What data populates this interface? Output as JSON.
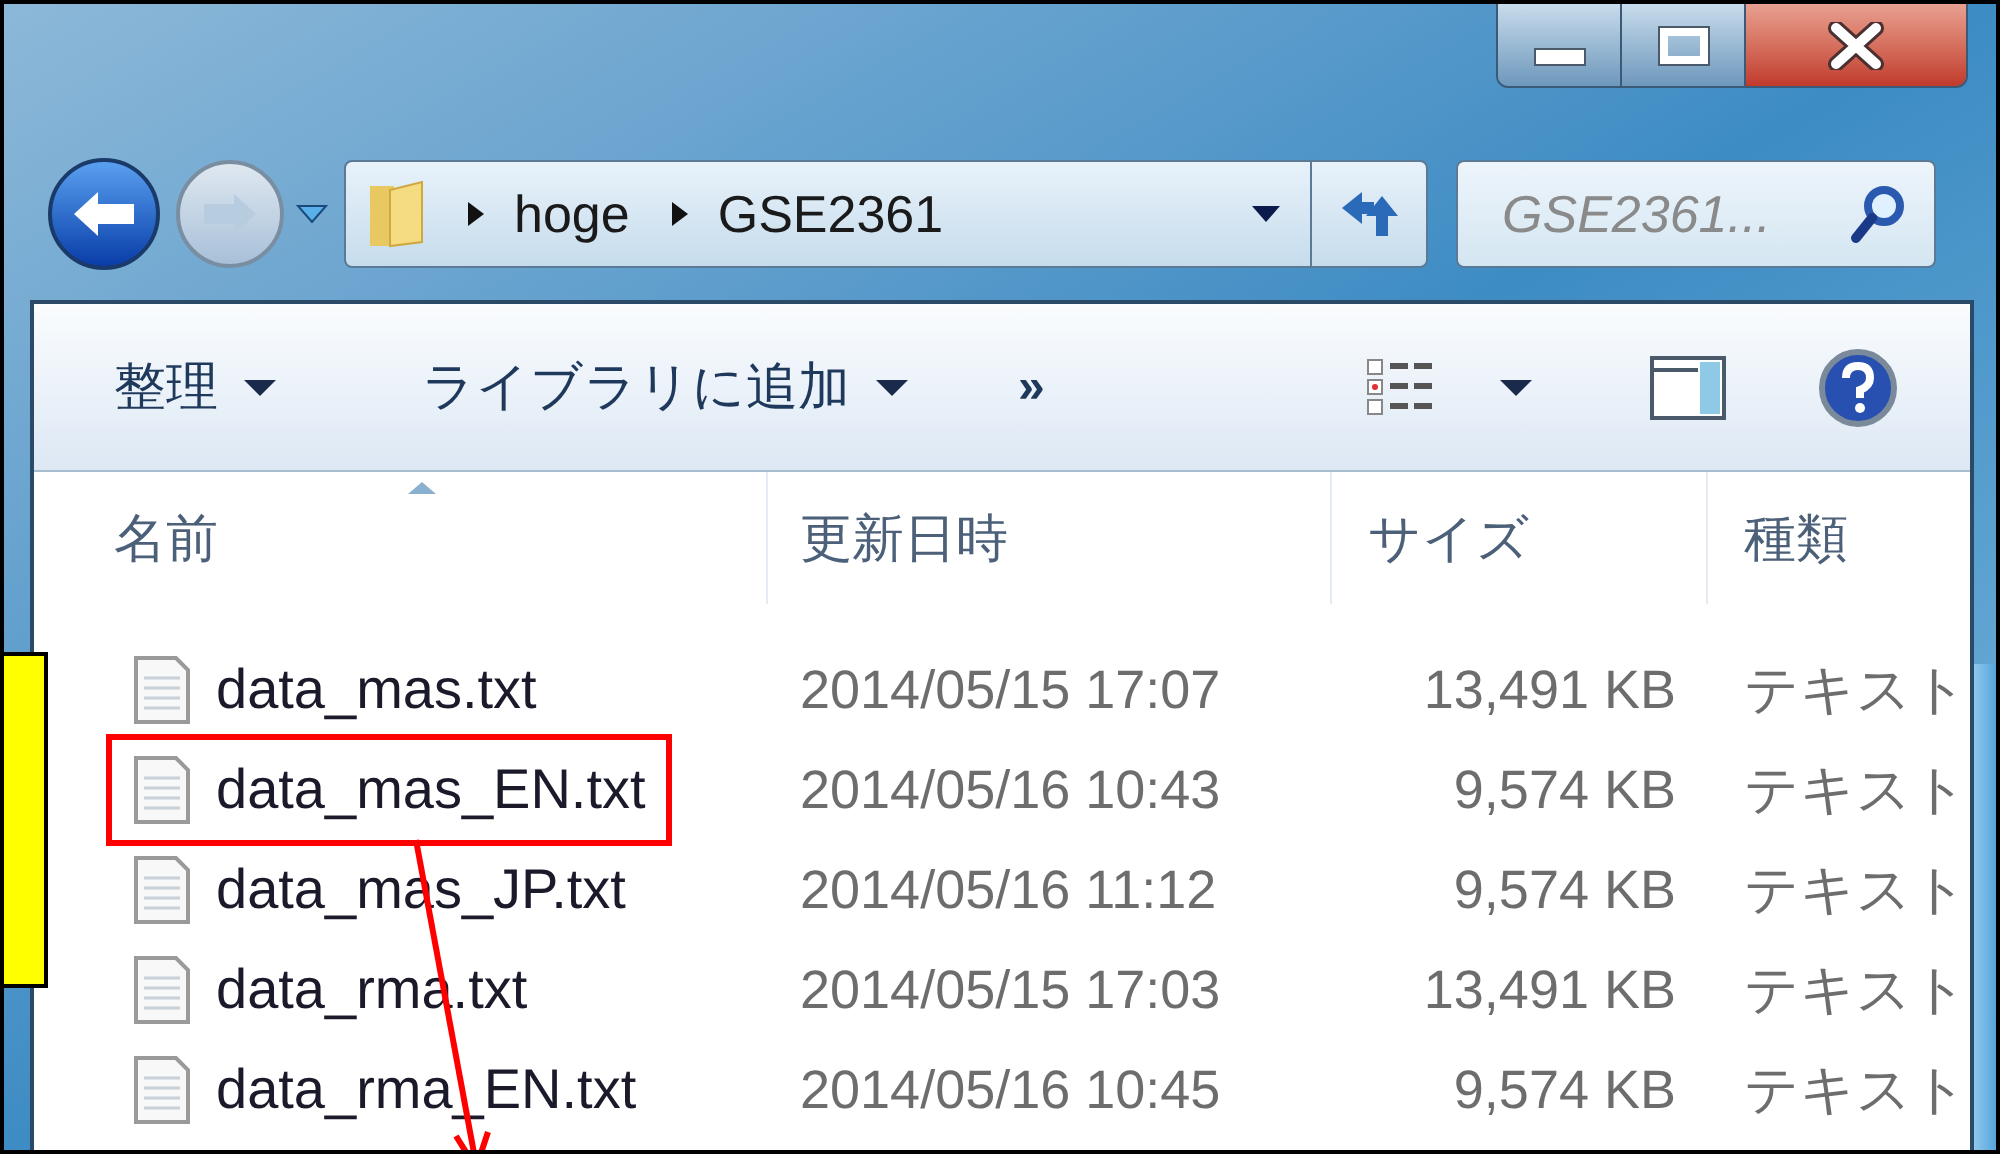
{
  "address_bar": {
    "path": [
      "hoge",
      "GSE2361"
    ]
  },
  "search": {
    "placeholder": "GSE2361..."
  },
  "toolbar": {
    "items": [
      {
        "label": "整理",
        "kind": "menu"
      },
      {
        "label": "ライブラリに追加",
        "kind": "menu"
      },
      {
        "label": "»",
        "kind": "more"
      }
    ]
  },
  "table": {
    "columns": [
      "名前",
      "更新日時",
      "サイズ",
      "種類"
    ],
    "rows": [
      {
        "name": "data_mas.txt",
        "modified": "2014/05/15 17:07",
        "size": "13,491 KB",
        "type": "テキスト",
        "highlighted": false
      },
      {
        "name": "data_mas_EN.txt",
        "modified": "2014/05/16 10:43",
        "size": "9,574 KB",
        "type": "テキスト",
        "highlighted": true
      },
      {
        "name": "data_mas_JP.txt",
        "modified": "2014/05/16 11:12",
        "size": "9,574 KB",
        "type": "テキスト",
        "highlighted": false
      },
      {
        "name": "data_rma.txt",
        "modified": "2014/05/15 17:03",
        "size": "13,491 KB",
        "type": "テキスト",
        "highlighted": false
      },
      {
        "name": "data_rma_EN.txt",
        "modified": "2014/05/16 10:45",
        "size": "9,574 KB",
        "type": "テキスト",
        "highlighted": false
      }
    ]
  }
}
